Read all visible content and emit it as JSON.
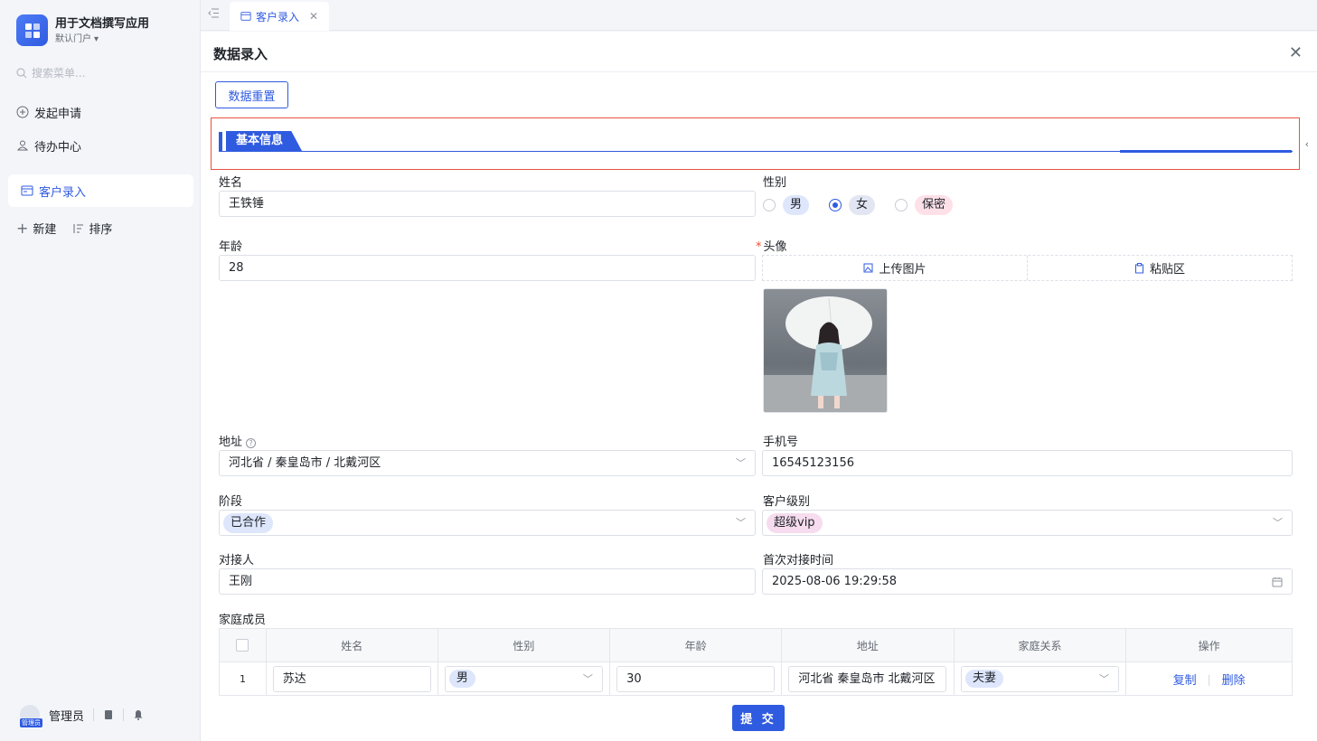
{
  "app": {
    "title": "用于文档撰写应用",
    "portal": "默认门户"
  },
  "sidebar": {
    "search_placeholder": "搜索菜单...",
    "items": [
      {
        "label": "发起申请",
        "icon": "plus-circle-icon"
      },
      {
        "label": "待办中心",
        "icon": "user-task-icon"
      },
      {
        "label": "客户录入",
        "icon": "form-icon",
        "active": true
      }
    ],
    "new_label": "新建",
    "sort_label": "排序",
    "user_name": "管理员",
    "user_tag": "管理员"
  },
  "tabs": [
    {
      "label": "客户录入",
      "active": true
    }
  ],
  "dialog": {
    "title": "数据录入",
    "reset_label": "数据重置",
    "section_title": "基本信息",
    "submit_label": "提 交"
  },
  "form": {
    "name": {
      "label": "姓名",
      "value": "王铁锤"
    },
    "gender": {
      "label": "性别",
      "options": [
        "男",
        "女",
        "保密"
      ],
      "selected": "女"
    },
    "age": {
      "label": "年龄",
      "value": "28"
    },
    "avatar": {
      "label": "头像",
      "required": true,
      "upload_label": "上传图片",
      "paste_label": "粘贴区"
    },
    "address": {
      "label": "地址",
      "value": "河北省 / 秦皇岛市 / 北戴河区"
    },
    "phone": {
      "label": "手机号",
      "value": "16545123156"
    },
    "stage": {
      "label": "阶段",
      "value": "已合作"
    },
    "level": {
      "label": "客户级别",
      "value": "超级vip"
    },
    "contact": {
      "label": "对接人",
      "value": "王刚"
    },
    "first_contact": {
      "label": "首次对接时间",
      "value": "2025-08-06 19:29:58"
    },
    "family": {
      "label": "家庭成员",
      "columns": [
        "姓名",
        "性别",
        "年龄",
        "地址",
        "家庭关系",
        "操作"
      ],
      "rows": [
        {
          "index": "1",
          "name": "苏达",
          "gender": "男",
          "age": "30",
          "address": "河北省 秦皇岛市 北戴河区",
          "relation": "夫妻",
          "copy": "复制",
          "delete": "删除"
        }
      ]
    }
  },
  "colors": {
    "accent": "#2f5be0",
    "highlight_border": "#e8533f"
  }
}
